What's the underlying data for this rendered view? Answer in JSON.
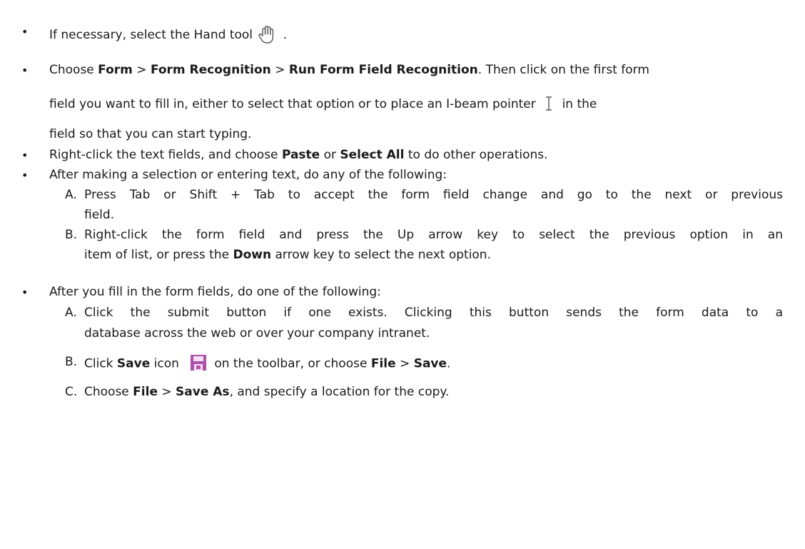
{
  "items": {
    "hand": {
      "text_before": "If necessary, select the Hand tool",
      "icon": "hand-tool-icon",
      "text_after": "."
    },
    "form_recog": {
      "choose": "Choose",
      "form": "Form",
      "sep": ">",
      "form_recognition": "Form Recognition",
      "run_recognition": "Run Form Field Recognition",
      "line1_tail": ". Then click on the first form",
      "line2_before": "field you want to fill in, either to select that option or to place an I-beam pointer",
      "ibeam_icon": "i-beam-pointer-icon",
      "line2_after": "in the",
      "line3": "field so that you can start typing."
    },
    "rightclick": {
      "before": "Right-click the text fields, and choose",
      "paste": "Paste",
      "or": "or",
      "select_all": "Select All",
      "after": "to do other operations."
    },
    "after_selection": {
      "text": "After making a selection or entering text, do any of the following:",
      "sub_a_label": "A.",
      "sub_a_line1": "Press Tab or Shift + Tab to accept the form field change and go to the next or previous",
      "sub_a_line2": "field.",
      "sub_b_label": "B.",
      "sub_b_line1": "Right-click the form field and press the Up arrow key to select the previous option in an",
      "sub_b_line2_before": "item of list, or press the",
      "sub_b_down": "Down",
      "sub_b_line2_after": "arrow key to select the next option."
    },
    "after_fill": {
      "text": "After you fill in the form fields, do one of the following:",
      "sub_a_label": "A.",
      "sub_a_line1": "Click the submit button if one exists. Clicking this button sends the form data to a",
      "sub_a_line2": "database across the web or over your company intranet.",
      "sub_b_label": "B.",
      "sub_b_click": "Click",
      "sub_b_save": "Save",
      "sub_b_icon_word": "icon",
      "save_icon": "save-disk-icon",
      "sub_b_toolbar": "on the toolbar, or choose",
      "sub_b_file": "File",
      "sub_b_sep": ">",
      "sub_b_save2": "Save",
      "sub_b_end": ".",
      "sub_c_label": "C.",
      "sub_c_choose": "Choose",
      "sub_c_file": "File",
      "sub_c_sep": ">",
      "sub_c_saveas": "Save As",
      "sub_c_end": ", and specify a location for the copy."
    }
  },
  "bullet_char": "•",
  "colors": {
    "text": "#1a1a1a",
    "save_icon": "#b04fb0"
  }
}
